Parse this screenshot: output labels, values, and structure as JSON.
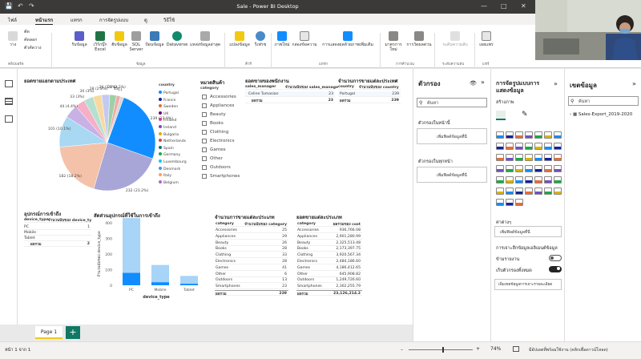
{
  "app": {
    "title": "Sale - Power BI Desktop"
  },
  "menu": [
    "ไฟล์",
    "หน้าแรก",
    "แทรก",
    "การจัดรูปแบบ",
    "ดู",
    "วิธีใช้"
  ],
  "ribbon": {
    "clipboard": [
      "วาง",
      "ตัด",
      "คัดลอก",
      "ตัวคัดวาง",
      "คลิปบอร์ด"
    ],
    "data": [
      "รับข้อมูล",
      "เวิร์กบุ๊ก Excel",
      "ฮับข้อมูล",
      "SQL Server",
      "ป้อนข้อมูล",
      "Dataverse",
      "แหล่งข้อมูลล่าสุด",
      "ข้อมูล"
    ],
    "queries": [
      "แปลงข้อมูล",
      "รีเฟรช",
      "คิวรี"
    ],
    "insert": [
      "ภาพใหม่",
      "กล่องข้อความ",
      "การแสดงผลด้วยภาพเพิ่มเติม",
      "แทรก"
    ],
    "calc": [
      "มาตรการใหม่",
      "การวัดผลด่วน",
      "การคำนวณ"
    ],
    "sensitivity": [
      "ระดับความลับ",
      "ระดับความลับ"
    ],
    "share": [
      "เผยแพร่",
      "แชร์"
    ]
  },
  "left_rail": [
    "report-view-icon",
    "table-view-icon",
    "model-view-icon"
  ],
  "pie": {
    "title": "ยอดขายแยกตามประเทศ",
    "legend_title": "country",
    "legend": [
      "Portugal",
      "France",
      "Sweden",
      "UK",
      "Finland",
      "Ireland",
      "Bulgaria",
      "Netherlands",
      "Spain",
      "Germany",
      "Luxembourg",
      "Denmark",
      "Italy",
      "Belgium"
    ],
    "labels": [
      "239 (23.9%)",
      "232 (23.2%)",
      "182 (18.2%)",
      "101 (10.1%)",
      "44 (4.4%)",
      "33 (3%)",
      "30 (3%)",
      "28 (2.8%)",
      "26 (2.6%)",
      "22 (2.2%)",
      "13",
      "11"
    ]
  },
  "slicer": {
    "title": "หมวดสินค้า",
    "field": "category",
    "items": [
      "Accessories",
      "Appliances",
      "Beauty",
      "Books",
      "Clothing",
      "Electronics",
      "Games",
      "Other",
      "Outdoors",
      "Smartphones"
    ]
  },
  "sales_mgr": {
    "title": "ยอดขายของพนักงาน",
    "headers": [
      "sales_manager",
      "จำนวนนับของ sales_manage"
    ],
    "rows": [
      [
        "Celine Tumasian",
        "23"
      ]
    ],
    "total": [
      "ผลรวม",
      "23"
    ]
  },
  "country_tbl": {
    "title": "จำนวนการขายแต่ละประเทศ",
    "headers": [
      "country",
      "จำนวนนับของ country"
    ],
    "rows": [
      [
        "Portugal",
        "239"
      ]
    ],
    "total": [
      "ผลรวม",
      "239"
    ]
  },
  "device_tbl": {
    "title": "อุปกรณ์การเข้าถึง",
    "headers": [
      "device_type",
      "จำนวนนับของ device_ty"
    ],
    "rows": [
      [
        "PC",
        "1"
      ],
      [
        "Mobile",
        ""
      ],
      [
        "Tablet",
        ""
      ]
    ],
    "total": [
      "ผลรวม",
      "2"
    ]
  },
  "chart_data": {
    "type": "bar",
    "title": "สัดส่วนอุปกรณ์ที่ใช้ในการเข้าถึง",
    "categories": [
      "PC",
      "Mobile",
      "Tablet"
    ],
    "series": [
      {
        "name": "",
        "values": [
          350,
          110,
          50
        ]
      },
      {
        "name": "",
        "values": [
          80,
          20,
          10
        ]
      }
    ],
    "xlabel": "device_type",
    "ylabel": "จำนวนนับของ device_type",
    "ylim": [
      0,
      400
    ],
    "ticks": [
      "0",
      "100",
      "200",
      "300",
      "400"
    ],
    "stacked": true,
    "colors": [
      "#a8d4f7",
      "#118dff"
    ]
  },
  "cat_count": {
    "title": "จำนวนการขายแต่ละประเภท",
    "headers": [
      "category",
      "จำนวนนับของ category"
    ],
    "rows": [
      [
        "Accessories",
        "25"
      ],
      [
        "Appliances",
        "29"
      ],
      [
        "Beauty",
        "26"
      ],
      [
        "Books",
        "28"
      ],
      [
        "Clothing",
        "33"
      ],
      [
        "Electronics",
        "28"
      ],
      [
        "Games",
        "41"
      ],
      [
        "Other",
        "6"
      ],
      [
        "Outdoors",
        "13"
      ],
      [
        "Smartphones",
        "23"
      ]
    ],
    "total": [
      "ผลรวม",
      "239"
    ]
  },
  "cat_sales": {
    "title": "ยอดขายแต่ละประเภท",
    "headers": [
      "category",
      "ผลรวมของ cost"
    ],
    "rows": [
      [
        "Accessories",
        "936,766.08"
      ],
      [
        "Appliances",
        "2,901,280.99"
      ],
      [
        "Beauty",
        "2,325,513.48"
      ],
      [
        "Books",
        "2,173,397.75"
      ],
      [
        "Clothing",
        "3,920,567.34"
      ],
      [
        "Electronics",
        "2,484,186.60"
      ],
      [
        "Games",
        "4,186,412.65"
      ],
      [
        "Other",
        "645,908.82"
      ],
      [
        "Outdoors",
        "1,249,726.60"
      ],
      [
        "Smartphones",
        "2,302,255.79"
      ]
    ],
    "total": [
      "ผลรวม",
      "23,126,214.2"
    ]
  },
  "page": {
    "tab": "Page 1",
    "status": "หน้า 1 จาก 1",
    "zoom": "74%",
    "update": "มีอัปเดตที่พร้อมใช้งาน (คลิกเพื่อดาวน์โหลด)"
  },
  "filters": {
    "title": "ตัวกรอง",
    "search": "ค้นหา",
    "on_page": "ตัวกรองในหน้านี้",
    "add1": "เพิ่มฟิลด์ข้อมูลที่นี่",
    "all_pages": "ตัวกรองในทุกหน้า",
    "add2": "เพิ่มฟิลด์ข้อมูลที่นี่"
  },
  "viz": {
    "title": "การจัดรูปแบบการแสดงข้อมูล",
    "build": "สร้างภาพ",
    "values": "ค่าต่างๆ",
    "add": "เพิ่มฟิลด์ข้อมูลที่นี่",
    "drill": "การเจาะลึกข้อมูลเอลิเมนต์ข้อมูล",
    "cross": "ข้ามรายงาน",
    "keep": "เก็บตัวกรองทั้งหมด",
    "drill_add": "เพิ่มเขตข้อมูลการเจาะรายละเอียด",
    "cross_state": "ปิด",
    "keep_state": "เปิด"
  },
  "fields": {
    "title": "เขตข้อมูล",
    "search": "ค้นหา",
    "table": "Sales-Export_2019-2020"
  }
}
